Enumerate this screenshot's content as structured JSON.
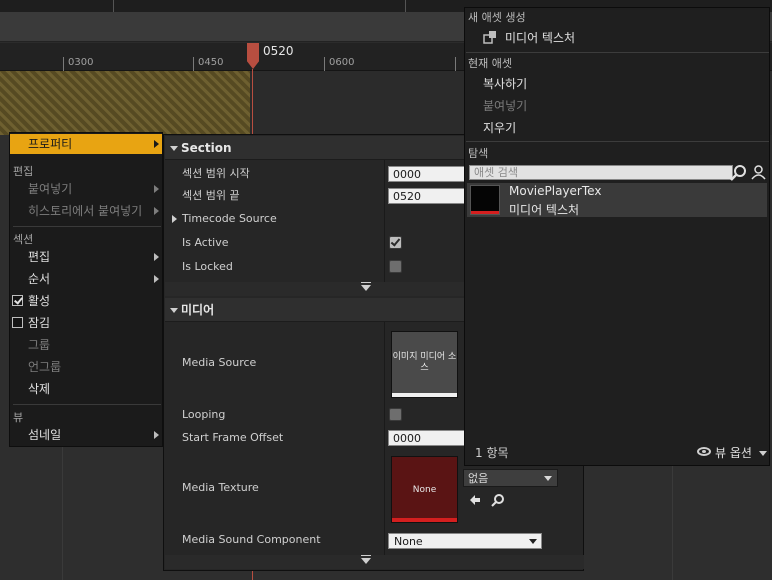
{
  "sequencer": {
    "ruler_labels": [
      "0300",
      "0450",
      "0600"
    ],
    "playhead_label": "0520",
    "colors": {
      "playhead": "#b84e40",
      "section_bar": "#6e6030"
    }
  },
  "context_menu": {
    "properties_label": "프로퍼티",
    "edit_header": "편집",
    "paste_label": "붙여넣기",
    "paste_history_label": "히스토리에서 붙여넣기",
    "section_header": "섹션",
    "edit_label": "편집",
    "order_label": "순서",
    "active_label": "활성",
    "active_checked": true,
    "locked_label": "잠김",
    "locked_checked": false,
    "group_label": "그룹",
    "ungroup_label": "언그룹",
    "delete_label": "삭제",
    "view_header": "뷰",
    "thumbnail_label": "섬네일",
    "highlight_color": "#e8a412"
  },
  "properties": {
    "section_header": "Section",
    "range_start_label": "섹션 범위 시작",
    "range_start_value": "0000",
    "range_end_label": "섹션 범위 끝",
    "range_end_value": "0520",
    "timecode_source_label": "Timecode Source",
    "is_active_label": "Is Active",
    "is_active": true,
    "is_locked_label": "Is Locked",
    "is_locked": false,
    "media_header": "미디어",
    "media_source_label": "Media Source",
    "media_source_thumb_text": "이미지 미디어 소스",
    "looping_label": "Looping",
    "looping": false,
    "start_frame_offset_label": "Start Frame Offset",
    "start_frame_offset_value": "0000",
    "media_texture_label": "Media Texture",
    "media_texture_thumb_text": "None",
    "media_texture_dropdown": "없음",
    "media_sound_label": "Media Sound Component",
    "media_sound_value": "None",
    "colors": {
      "texture_thumb": "#5a1414",
      "texture_bar": "#d41f1f"
    }
  },
  "asset_picker": {
    "create_header": "새 애셋 생성",
    "create_item": "미디어 텍스처",
    "current_header": "현재 애셋",
    "copy_label": "복사하기",
    "paste_label": "붙여넣기",
    "clear_label": "지우기",
    "browse_header": "탐색",
    "search_placeholder": "애셋 검색",
    "asset_name": "MoviePlayerTex",
    "asset_type": "미디어 텍스처",
    "item_count": "1 항목",
    "view_options": "뷰 옵션"
  }
}
